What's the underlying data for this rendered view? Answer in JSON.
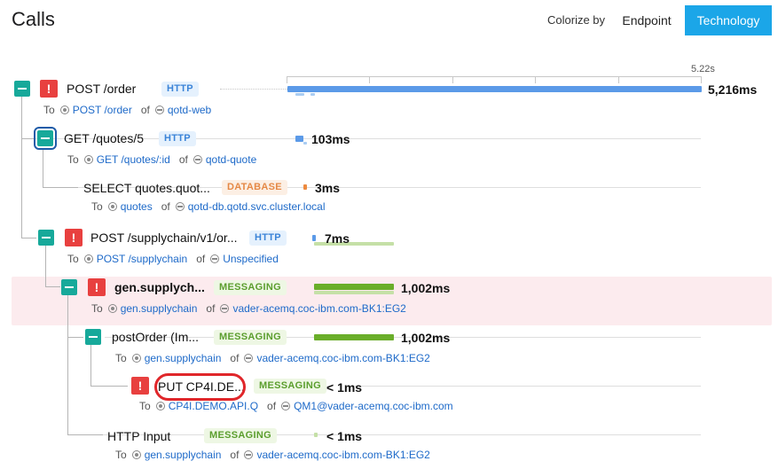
{
  "header": {
    "title": "Calls",
    "colorize_label": "Colorize by",
    "endpoint_button": "Endpoint",
    "technology_button": "Technology"
  },
  "timeline": {
    "max_label": "5.22s"
  },
  "colors": {
    "http": "#5b9ae8",
    "database": "#ed8a3f",
    "messaging": "#6aae2a",
    "error": "#e8403f",
    "toggle": "#17a99a",
    "active_button": "#1ba6e8",
    "highlight_row": "#fcebee",
    "annotation_circle": "#e0262a"
  },
  "to_label": "To",
  "of_label": "of",
  "calls": [
    {
      "name": "POST /order",
      "tech": "HTTP",
      "duration": "5,216ms",
      "duration_ms": 5216,
      "error": true,
      "collapsible": true,
      "endpoint": "POST /order",
      "service": "qotd-web"
    },
    {
      "name": "GET /quotes/5",
      "tech": "HTTP",
      "duration": "103ms",
      "duration_ms": 103,
      "error": false,
      "collapsible": true,
      "endpoint": "GET /quotes/:id",
      "service": "qotd-quote"
    },
    {
      "name": "SELECT quotes.quot...",
      "tech": "DATABASE",
      "duration": "3ms",
      "duration_ms": 3,
      "error": false,
      "collapsible": false,
      "endpoint": "quotes",
      "service": "qotd-db.qotd.svc.cluster.local"
    },
    {
      "name": "POST /supplychain/v1/or...",
      "tech": "HTTP",
      "duration": "7ms",
      "duration_ms": 7,
      "error": true,
      "collapsible": true,
      "endpoint": "POST /supplychain",
      "service": "Unspecified"
    },
    {
      "name": "gen.supplych...",
      "tech": "MESSAGING",
      "duration": "1,002ms",
      "duration_ms": 1002,
      "error": true,
      "collapsible": true,
      "endpoint": "gen.supplychain",
      "service": "vader-acemq.coc-ibm.com-BK1:EG2"
    },
    {
      "name": "postOrder (Im...",
      "tech": "MESSAGING",
      "duration": "1,002ms",
      "duration_ms": 1002,
      "error": false,
      "collapsible": true,
      "endpoint": "gen.supplychain",
      "service": "vader-acemq.coc-ibm.com-BK1:EG2"
    },
    {
      "name": "PUT CP4I.DE...",
      "tech": "MESSAGING",
      "duration": "< 1ms",
      "duration_ms": 0.5,
      "error": true,
      "collapsible": false,
      "endpoint": "CP4I.DEMO.API.Q",
      "service": "QM1@vader-acemq.coc-ibm.com"
    },
    {
      "name": "HTTP Input",
      "tech": "MESSAGING",
      "duration": "< 1ms",
      "duration_ms": 0.5,
      "error": false,
      "collapsible": false,
      "endpoint": "gen.supplychain",
      "service": "vader-acemq.coc-ibm.com-BK1:EG2"
    }
  ]
}
